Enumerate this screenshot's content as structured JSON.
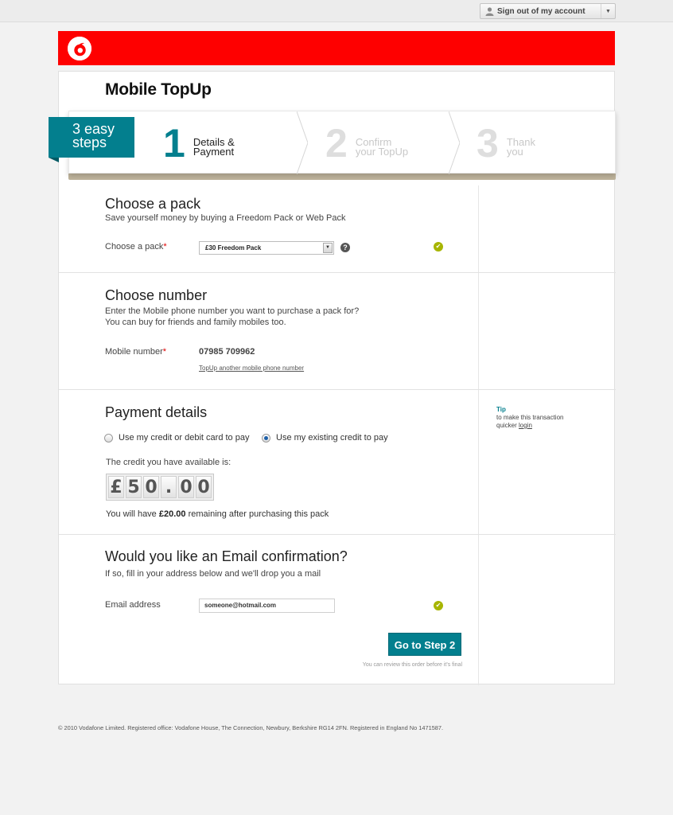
{
  "header": {
    "signout_label": "Sign out of my account"
  },
  "page": {
    "title": "Mobile TopUp"
  },
  "steps": {
    "tag": [
      "3 easy",
      "steps"
    ],
    "items": [
      {
        "number": "1",
        "line1": "Details &",
        "line2": "Payment"
      },
      {
        "number": "2",
        "line1": "Confirm",
        "line2": "your TopUp"
      },
      {
        "number": "3",
        "line1": "Thank",
        "line2": "you"
      }
    ]
  },
  "pack": {
    "title": "Choose a pack",
    "subtitle": "Save yourself money by buying a Freedom Pack or Web Pack",
    "label": "Choose a pack",
    "required_mark": "*",
    "selected": "£30 Freedom Pack",
    "help": "?"
  },
  "number": {
    "title": "Choose number",
    "line1": "Enter the Mobile phone number you want to purchase a pack for?",
    "line2": "You can buy for friends and family mobiles too.",
    "label": "Mobile number",
    "required_mark": "*",
    "value": "07985 709962",
    "another_link": "TopUp another mobile phone number"
  },
  "payment": {
    "title": "Payment details",
    "option_card": "Use my credit or debit card to pay",
    "option_credit": "Use my existing credit to pay",
    "selected_option": "credit",
    "available_label": "The credit you have available is:",
    "credit_digits": [
      "£",
      "5",
      "0",
      ".",
      "0",
      "0"
    ],
    "remain_before": "You will have ",
    "remain_amount": "£20.00",
    "remain_after": " remaining after purchasing this pack",
    "tip_heading": "Tip",
    "tip_line1": "to make this transaction",
    "tip_line2": "quicker ",
    "tip_link": "login"
  },
  "email": {
    "title": "Would you like an Email confirmation?",
    "subtitle": "If so, fill in your address below and we'll drop you a mail",
    "label": "Email address",
    "value": "someone@hotmail.com",
    "button": "Go to Step 2",
    "note": "You can review this order before it's final"
  },
  "footer": {
    "text": "© 2010 Vodafone Limited. Registered office: Vodafone House, The Connection, Newbury, Berkshire RG14 2FN. Registered in England No 1471587."
  },
  "colors": {
    "brand_red": "#fe0000",
    "accent_teal": "#037f8e",
    "ok_green": "#a7b500"
  }
}
